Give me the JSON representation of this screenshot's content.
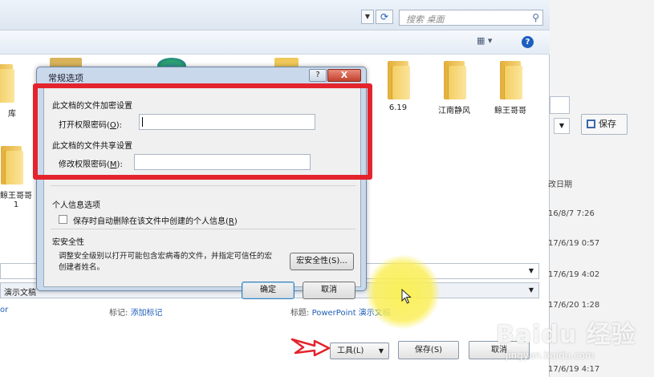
{
  "search": {
    "placeholder": "搜索 桌面"
  },
  "folders": [
    {
      "name": "6.19"
    },
    {
      "name": "江南静风"
    },
    {
      "name": "鲸王哥哥"
    },
    {
      "name": "鲸王哥哥1"
    }
  ],
  "left_labels": {
    "library": "库"
  },
  "side": {
    "save_label": "保存",
    "modified_header": "改日期",
    "dates": [
      "16/8/7 7:26",
      "17/6/19 0:57",
      "17/6/19 4:02",
      "17/6/20 1:28",
      "17/6/19 4:17"
    ]
  },
  "file": {
    "save_type": "演示文稿",
    "author_prefix": "or",
    "tags_label": "标记:",
    "tags_value": "添加标记",
    "title_label": "标题:",
    "title_value": "PowerPoint 演示文稿"
  },
  "buttons": {
    "tools": "工具(L)",
    "save": "保存(S)",
    "cancel": "取消"
  },
  "options_dialog": {
    "title": "常规选项",
    "help": "?",
    "close": "X",
    "encrypt_section": "此文档的文件加密设置",
    "open_password_label": "打开权限密码(",
    "open_password_key": "O",
    "open_password_suffix": "):",
    "share_section": "此文档的文件共享设置",
    "modify_password_label": "修改权限密码(",
    "modify_password_key": "M",
    "modify_password_suffix": "):",
    "privacy_section": "个人信息选项",
    "remove_info_label": "保存时自动删除在该文件中创建的个人信息(",
    "remove_info_key": "R",
    "remove_info_suffix": ")",
    "macro_section": "宏安全性",
    "macro_description": "调整安全级别以打开可能包含宏病毒的文件，并指定可信任的宏创建者姓名。",
    "macro_button": "宏安全性(S)...",
    "ok": "确定",
    "cancel": "取消"
  },
  "watermark": {
    "brand": "Baidu 经验",
    "url": "jingyan.baidu.com"
  },
  "colors": {
    "highlight_red": "#e4242d",
    "cursor_yellow": "#f8ec55",
    "folder_yellow": "#f3cf64"
  }
}
